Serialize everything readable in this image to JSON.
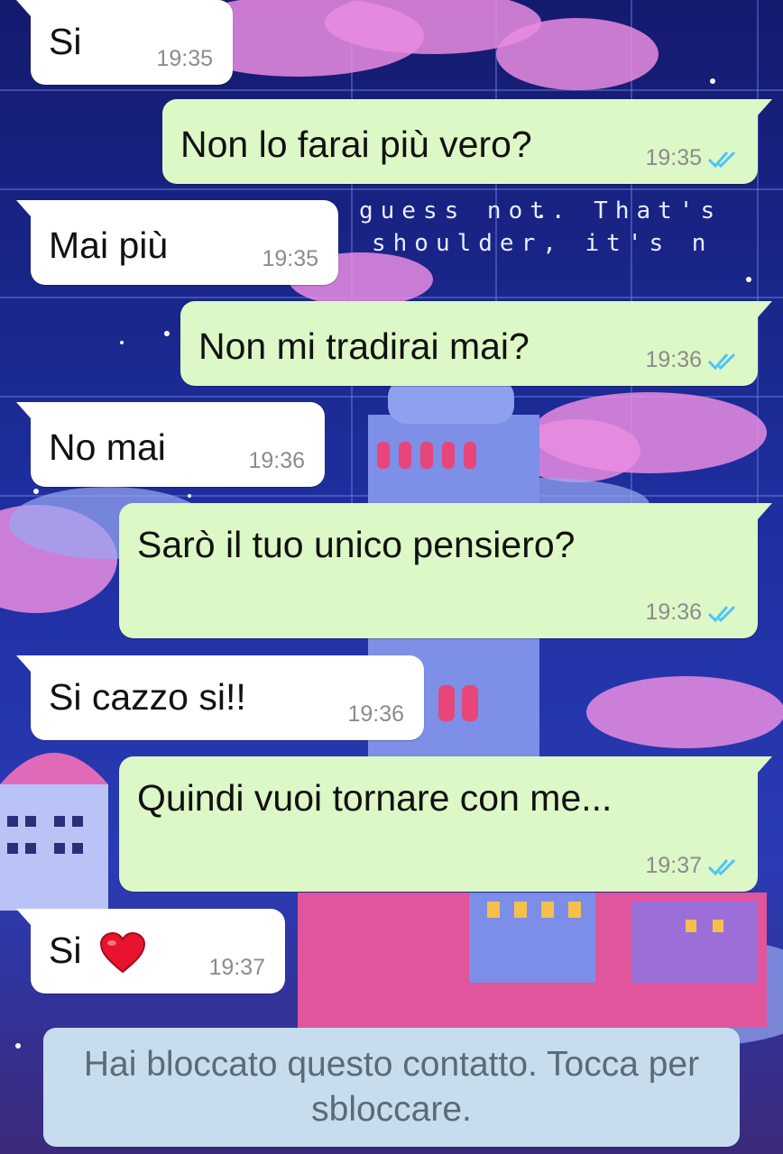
{
  "messages": [
    {
      "id": "m1",
      "side": "in",
      "text": "Si",
      "time": "19:35"
    },
    {
      "id": "m2",
      "side": "out",
      "text": "Non lo farai più vero?",
      "time": "19:35",
      "read": true
    },
    {
      "id": "m3",
      "side": "in",
      "text": "Mai più",
      "time": "19:35"
    },
    {
      "id": "m4",
      "side": "out",
      "text": "Non mi tradirai mai?",
      "time": "19:36",
      "read": true
    },
    {
      "id": "m5",
      "side": "in",
      "text": "No mai",
      "time": "19:36"
    },
    {
      "id": "m6",
      "side": "out",
      "text": "Sarò il tuo unico pensiero?",
      "time": "19:36",
      "read": true
    },
    {
      "id": "m7",
      "side": "in",
      "text": "Si cazzo si!!",
      "time": "19:36"
    },
    {
      "id": "m8",
      "side": "out",
      "text": "Quindi vuoi tornare con me...",
      "time": "19:37",
      "read": true
    },
    {
      "id": "m9",
      "side": "in",
      "text": "Si",
      "emoji": "heart-emoji",
      "time": "19:37"
    }
  ],
  "wallpaper_text": {
    "line1": "guess not. That's",
    "line2": "shoulder, it's n"
  },
  "blocked_notice": "Hai bloccato questo contatto. Tocca per sbloccare.",
  "colors": {
    "incoming_bubble": "#ffffff",
    "outgoing_bubble": "#dcf8c6",
    "read_ticks": "#4fc3f7",
    "notice_bg": "#c7ddee"
  }
}
